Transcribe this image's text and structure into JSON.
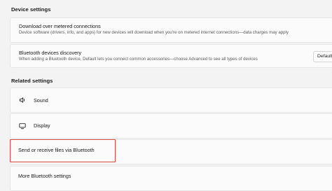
{
  "device_settings": {
    "heading": "Device settings",
    "metered": {
      "title": "Download over metered connections",
      "description": "Device software (drivers, info, and apps) for new devices will download when you're on metered internet connections—data charges may apply"
    },
    "bt_discovery": {
      "title": "Bluetooth devices discovery",
      "description": "When adding a Bluetooth device, Default lets you connect common accessories—choose Advanced to see all types of devices",
      "dropdown_value": "Default"
    }
  },
  "related_settings": {
    "heading": "Related settings",
    "items": [
      {
        "label": "Sound",
        "icon": "speaker-icon"
      },
      {
        "label": "Display",
        "icon": "monitor-icon"
      },
      {
        "label": "Send or receive files via Bluetooth",
        "icon": ""
      },
      {
        "label": "More Bluetooth settings",
        "icon": ""
      }
    ]
  },
  "colors": {
    "background": "#f3f3f3",
    "card": "#fbfbfb",
    "highlight": "#d14a3a"
  }
}
